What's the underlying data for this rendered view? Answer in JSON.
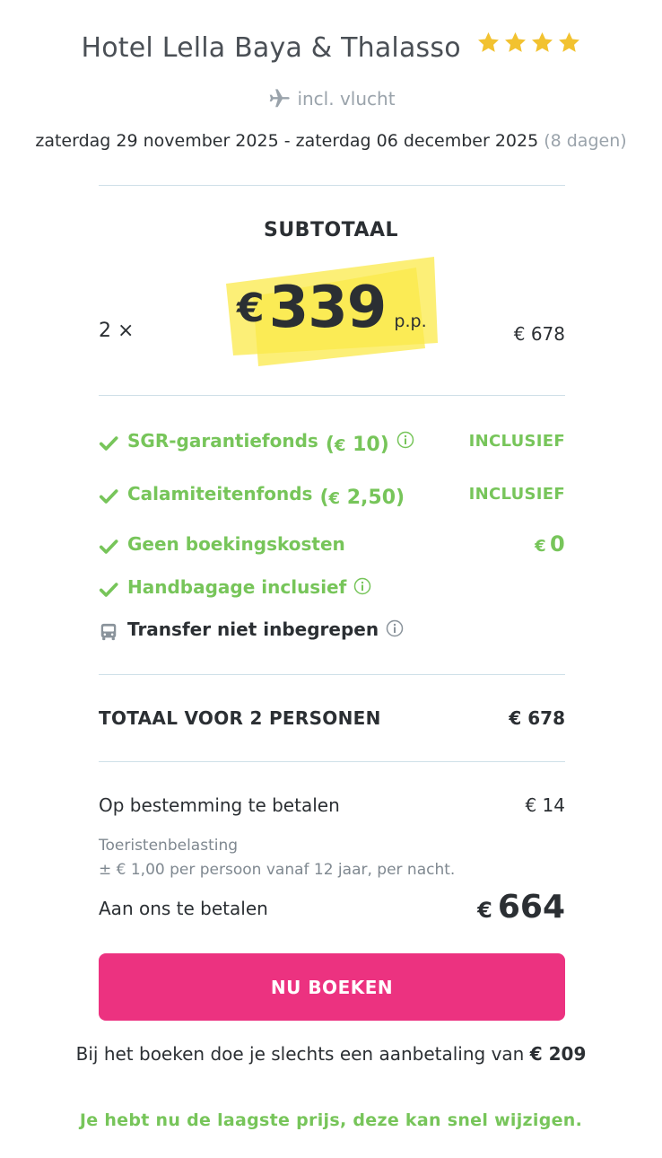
{
  "hotel": {
    "name": "Hotel Lella Baya & Thalasso",
    "stars": 4,
    "star_color": "#f2c230"
  },
  "flight": {
    "label": "incl. vlucht",
    "icon": "airplane-icon"
  },
  "dates": {
    "range": "zaterdag 29 november 2025 - zaterdag 06 december 2025",
    "duration": "(8 dagen)"
  },
  "subtotal": {
    "label": "SUBTOTAAL",
    "quantity": "2 ×",
    "currency": "€",
    "price": "339",
    "per_person": "p.p.",
    "line_total": "€ 678",
    "highlight_color": "#fbe94a"
  },
  "features": [
    {
      "label": "SGR-garantiefonds",
      "extra_currency": "€",
      "extra_open": "(",
      "extra_amount": "10)",
      "info": true,
      "right": "INCLUSIEF",
      "icon": "check-icon"
    },
    {
      "label": "Calamiteitenfonds",
      "extra_currency": "€",
      "extra_open": "(",
      "extra_amount": "2,50)",
      "info": false,
      "right": "INCLUSIEF",
      "icon": "check-icon"
    },
    {
      "label": "Geen boekingskosten",
      "right_currency": "€",
      "right_amount": "0",
      "icon": "check-icon"
    },
    {
      "label": "Handbagage inclusief",
      "info": true,
      "icon": "check-icon"
    },
    {
      "label": "Transfer niet inbegrepen",
      "info": true,
      "icon": "bus-icon"
    }
  ],
  "total": {
    "label": "TOTAAL VOOR 2 PERSONEN",
    "amount": "€ 678"
  },
  "destination": {
    "label": "Op bestemming te betalen",
    "amount": "€ 14",
    "tax_title": "Toeristenbelasting",
    "tax_desc": "± € 1,00 per persoon vanaf 12 jaar, per nacht."
  },
  "payable": {
    "label": "Aan ons te betalen",
    "currency": "€",
    "amount": "664"
  },
  "book_button": {
    "label": "NU BOEKEN",
    "color": "#ec3280"
  },
  "deposit": {
    "text": "Bij het boeken doe je slechts een aanbetaling van",
    "amount": "€ 209"
  },
  "lowest_price": "Je hebt nu de laagste prijs, deze kan snel wijzigen.",
  "colors": {
    "accent_green": "#77c55a",
    "text_dark": "#2b2f33",
    "muted": "#9aa3ab"
  }
}
